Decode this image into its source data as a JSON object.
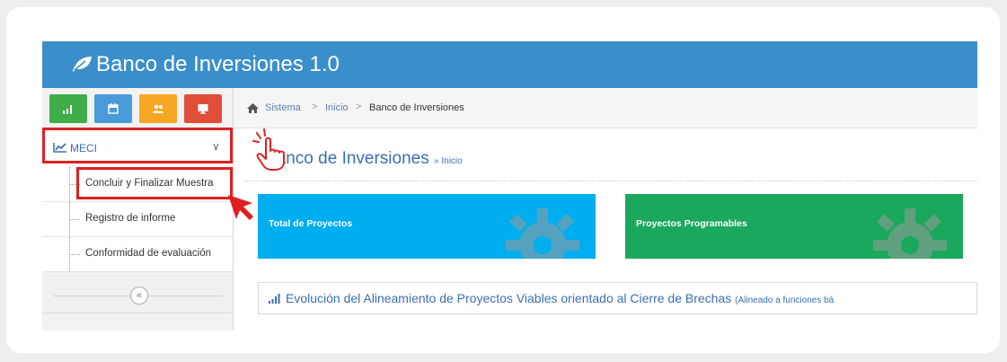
{
  "app": {
    "title": "Banco de Inversiones 1.0"
  },
  "shortcuts": [
    {
      "icon": "bar-chart-icon",
      "color": "#3fae49"
    },
    {
      "icon": "calendar-icon",
      "color": "#4a9bd9"
    },
    {
      "icon": "users-icon",
      "color": "#f5a623"
    },
    {
      "icon": "monitor-icon",
      "color": "#e04e39"
    }
  ],
  "sidebar": {
    "menu": {
      "label": "MECI"
    },
    "items": [
      {
        "label": "Concluir y Finalizar Muestra"
      },
      {
        "label": "Registro de informe"
      },
      {
        "label": "Conformidad de evaluación"
      }
    ],
    "collapse_glyph": "«"
  },
  "breadcrumb": {
    "items": [
      "Sistema",
      "Inicio",
      "Banco de Inversiones"
    ],
    "separator": ">"
  },
  "page": {
    "heading": "Banco de Inversiones",
    "heading_suffix": "» Inicio"
  },
  "tiles": [
    {
      "label": "Total de Proyectos",
      "color": "#00aeef"
    },
    {
      "label": "Proyectos Programables",
      "color": "#1aa85c"
    }
  ],
  "evolution": {
    "title": "Evolución del Alineamiento de Proyectos Viables orientado al Cierre de Brechas",
    "suffix": "(Alineado a funciones bá"
  },
  "colors": {
    "header": "#3a8fcb",
    "highlight": "#e02020",
    "link": "#3a6fb0"
  }
}
